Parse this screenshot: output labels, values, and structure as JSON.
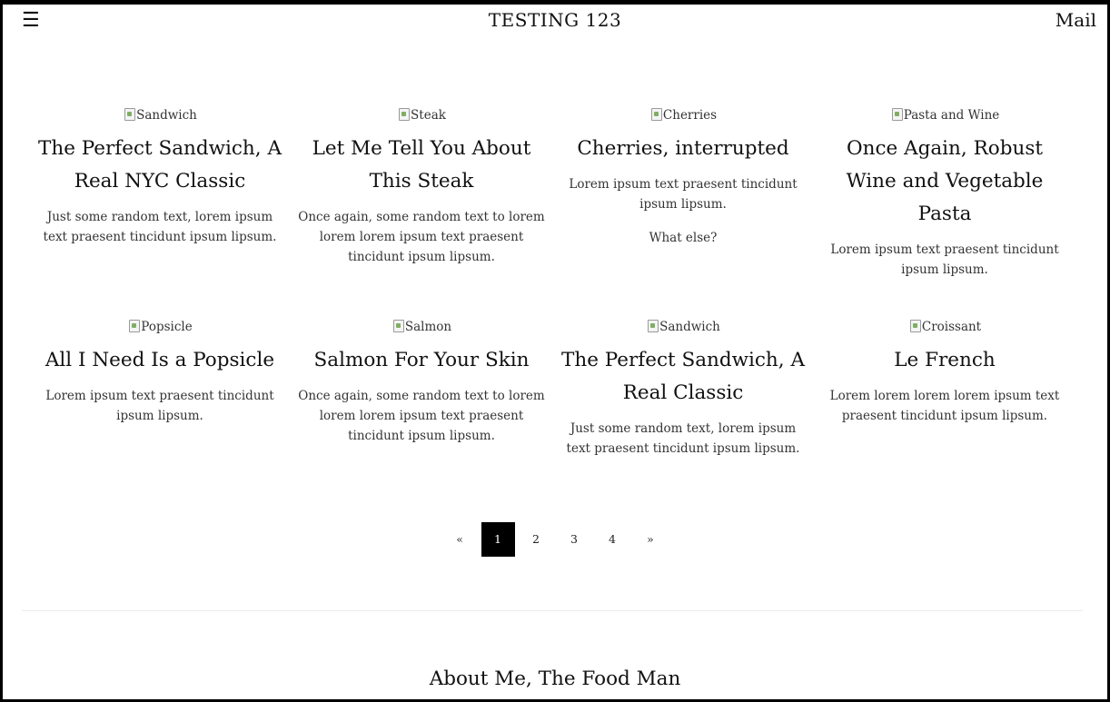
{
  "header": {
    "menu_icon": "☰",
    "title": "TESTING 123",
    "mail_label": "Mail"
  },
  "posts": [
    {
      "image_alt": "Sandwich",
      "title": "The Perfect Sandwich, A Real NYC Classic",
      "excerpt": "Just some random text, lorem ipsum text praesent tincidunt ipsum lipsum."
    },
    {
      "image_alt": "Steak",
      "title": "Let Me Tell You About This Steak",
      "excerpt": "Once again, some random text to lorem lorem lorem ipsum text praesent tincidunt ipsum lipsum."
    },
    {
      "image_alt": "Cherries",
      "title": "Cherries, interrupted",
      "excerpt": "Lorem ipsum text praesent tincidunt ipsum lipsum.",
      "excerpt_2": "What else?"
    },
    {
      "image_alt": "Pasta and Wine",
      "title": "Once Again, Robust Wine and Vegetable Pasta",
      "excerpt": "Lorem ipsum text praesent tincidunt ipsum lipsum."
    },
    {
      "image_alt": "Popsicle",
      "title": "All I Need Is a Popsicle",
      "excerpt": "Lorem ipsum text praesent tincidunt ipsum lipsum."
    },
    {
      "image_alt": "Salmon",
      "title": "Salmon For Your Skin",
      "excerpt": "Once again, some random text to lorem lorem lorem ipsum text praesent tincidunt ipsum lipsum."
    },
    {
      "image_alt": "Sandwich",
      "title": "The Perfect Sandwich, A Real Classic",
      "excerpt": "Just some random text, lorem ipsum text praesent tincidunt ipsum lipsum."
    },
    {
      "image_alt": "Croissant",
      "title": "Le French",
      "excerpt": "Lorem lorem lorem lorem ipsum text praesent tincidunt ipsum lipsum."
    }
  ],
  "pagination": {
    "prev": "«",
    "pages": [
      "1",
      "2",
      "3",
      "4"
    ],
    "active_page": "1",
    "next": "»"
  },
  "about": {
    "title": "About Me, The Food Man"
  }
}
